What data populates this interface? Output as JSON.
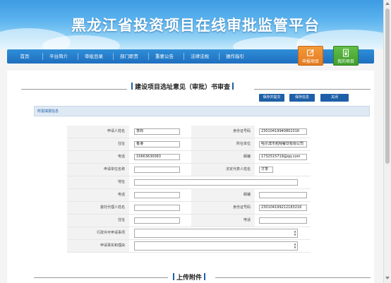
{
  "site": {
    "title": "黑龙江省投资项目在线审批监管平台"
  },
  "nav": {
    "items": [
      {
        "label": "首页"
      },
      {
        "label": "平台简介"
      },
      {
        "label": "审批目录"
      },
      {
        "label": "部门职责"
      },
      {
        "label": "重要公告"
      },
      {
        "label": "法律法规"
      },
      {
        "label": "操作指引"
      }
    ],
    "tiles": {
      "apply": {
        "label": "申报项目"
      },
      "mine": {
        "label": "我的项目"
      }
    }
  },
  "page": {
    "heading": "建设项目选址意见（审批）书审查",
    "buttons": {
      "save_submit": "保存并提交",
      "save_info": "保存信息",
      "close": "关闭"
    },
    "section_label": "所需填报信息",
    "upload_heading": "上传附件"
  },
  "form": {
    "applicant_name": {
      "label": "申请人姓名",
      "value": "李商"
    },
    "id_number": {
      "label": "身份证号码",
      "value": "23010419940802316"
    },
    "address": {
      "label": "住址",
      "value": "香港"
    },
    "work_unit": {
      "label": "所在单位",
      "value": "哈尔滨市拓翔餐饮有限公司"
    },
    "phone": {
      "label": "电话",
      "value": "15663630063"
    },
    "postcode": {
      "label": "邮编",
      "value": "1732515719@qq.com"
    },
    "unit_name": {
      "label": "申请单位名称",
      "value": ""
    },
    "legal_rep": {
      "label": "法定代表人姓名",
      "value": "才李"
    },
    "unit_address": {
      "label": "地址",
      "value": ""
    },
    "unit_phone": {
      "label": "电话",
      "value": ""
    },
    "unit_postcode": {
      "label": "邮编",
      "value": ""
    },
    "agent_name": {
      "label": "委托代理人姓名",
      "value": ""
    },
    "agent_id": {
      "label": "身份证号码",
      "value": "230104199212183216"
    },
    "agent_address": {
      "label": "住址",
      "value": ""
    },
    "agent_phone": {
      "label": "电话",
      "value": ""
    },
    "license_matter": {
      "label": "行政许可申请事项",
      "value": ""
    },
    "facts_reasons": {
      "label": "申请事实和理由",
      "value": ""
    }
  }
}
